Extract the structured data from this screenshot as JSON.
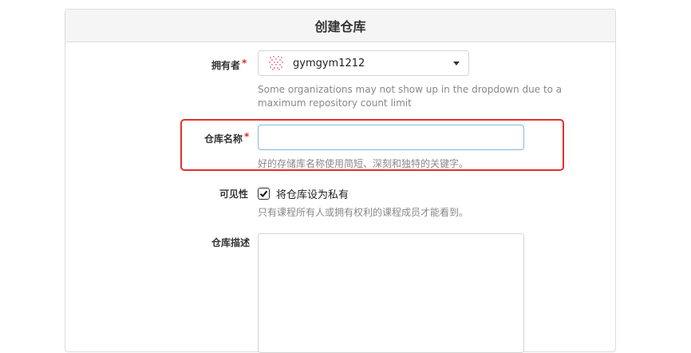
{
  "form": {
    "title": "创建仓库",
    "owner": {
      "label": "拥有者",
      "required_mark": "*",
      "selected": "gymgym1212",
      "avatar_icon": "identicon-avatar",
      "help": "Some organizations may not show up in the dropdown due to a maximum repository count limit"
    },
    "repo_name": {
      "label": "仓库名称",
      "required_mark": "*",
      "value": "",
      "help": "好的存储库名称使用简短、深刻和独特的关键字。"
    },
    "visibility": {
      "label": "可见性",
      "checkbox_label": "将仓库设为私有",
      "checked": true,
      "help": "只有课程所有人或拥有权利的课程成员才能看到。"
    },
    "description": {
      "label": "仓库描述",
      "value": ""
    }
  },
  "colors": {
    "highlight": "#e62e2e",
    "required": "#db2828",
    "focus_border": "#85b7d9"
  }
}
